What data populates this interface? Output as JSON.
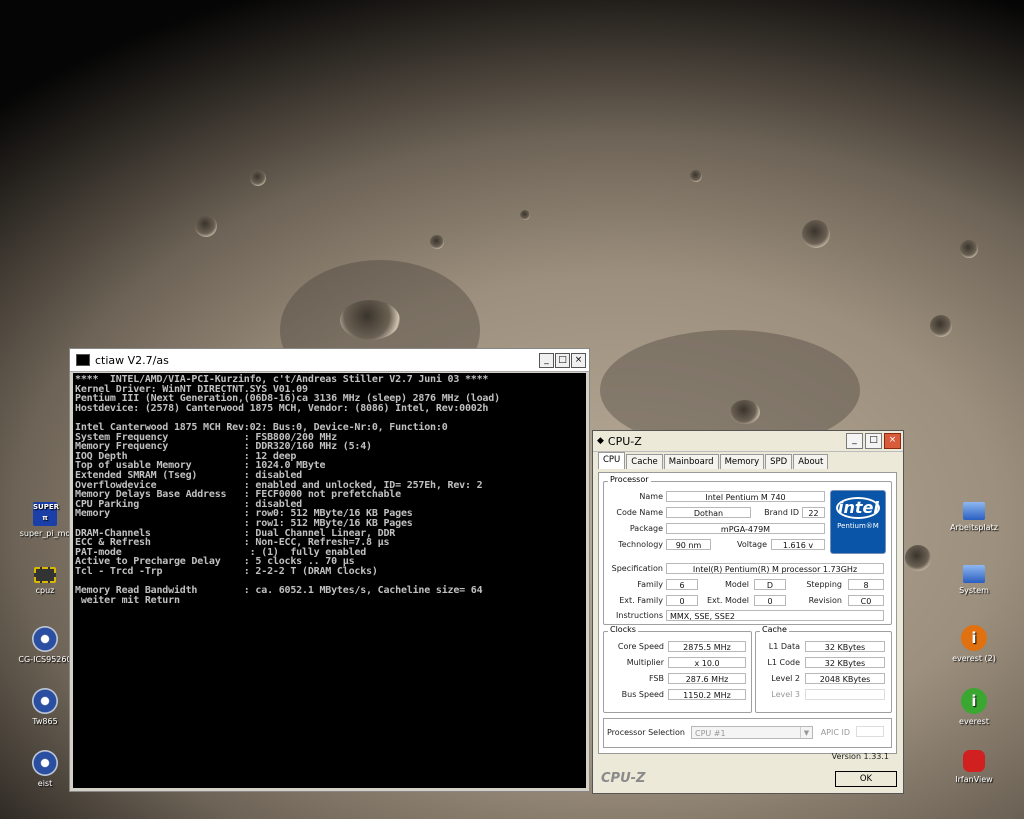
{
  "desktop": {
    "icons_left": [
      {
        "label": "super_pi_mo"
      },
      {
        "label": "cpuz"
      },
      {
        "label": "CG-ICS95260"
      },
      {
        "label": "Tw865"
      },
      {
        "label": "eist"
      }
    ],
    "icons_right": [
      {
        "label": "Arbeitsplatz"
      },
      {
        "label": "System"
      },
      {
        "label": "everest (2)"
      },
      {
        "label": "everest"
      },
      {
        "label": "IrfanView"
      }
    ]
  },
  "console": {
    "title": "ctiaw V2.7/as",
    "lines": [
      "****  INTEL/AMD/VIA-PCI-Kurzinfo, c't/Andreas Stiller V2.7 Juni 03 ****",
      "Kernel Driver: WinNT DIRECTNT.SYS V01.09",
      "Pentium III (Next Generation,(06D8-16)ca 3136 MHz (sleep) 2876 MHz (load)",
      "Hostdevice: (2578) Canterwood 1875 MCH, Vendor: (8086) Intel, Rev:0002h",
      "",
      "Intel Canterwood 1875 MCH Rev:02: Bus:0, Device-Nr:0, Function:0",
      "System Frequency             : FSB800/200 MHz",
      "Memory Frequency             : DDR320/160 MHz (5:4)",
      "IOQ Depth                    : 12 deep",
      "Top of usable Memory         : 1024.0 MByte",
      "Extended SMRAM (Tseg)        : disabled",
      "Overflowdevice               : enabled and unlocked, ID= 257Eh, Rev: 2",
      "Memory Delays Base Address   : FECF0000 not prefetchable",
      "CPU Parking                  : disabled",
      "Memory                       : row0: 512 MByte/16 KB Pages",
      "                             : row1: 512 MByte/16 KB Pages",
      "DRAM-Channels                : Dual Channel Linear, DDR",
      "ECC & Refresh                : Non-ECC, Refresh=7.8 µs",
      "PAT-mode                      : (1)  fully enabled",
      "Active to Precharge Delay    : 5 clocks .. 70 µs",
      "Tcl - Trcd -Trp              : 2-2-2 T (DRAM Clocks)",
      "",
      "Memory Read Bandwidth        : ca. 6052.1 MBytes/s, Cacheline size= 64",
      " weiter mit Return"
    ]
  },
  "cpuz": {
    "title": "CPU-Z",
    "tabs": [
      "CPU",
      "Cache",
      "Mainboard",
      "Memory",
      "SPD",
      "About"
    ],
    "processor": {
      "group": "Processor",
      "name_label": "Name",
      "name": "Intel Pentium M 740",
      "codename_label": "Code Name",
      "codename": "Dothan",
      "brandid_label": "Brand ID",
      "brandid": "22",
      "package_label": "Package",
      "package": "mPGA-479M",
      "technology_label": "Technology",
      "technology": "90 nm",
      "voltage_label": "Voltage",
      "voltage": "1.616 v",
      "spec_label": "Specification",
      "spec": "Intel(R) Pentium(R) M processor 1.73GHz",
      "family_label": "Family",
      "family": "6",
      "model_label": "Model",
      "model": "D",
      "stepping_label": "Stepping",
      "stepping": "8",
      "extfamily_label": "Ext. Family",
      "extfamily": "0",
      "extmodel_label": "Ext. Model",
      "extmodel": "0",
      "revision_label": "Revision",
      "revision": "C0",
      "instructions_label": "Instructions",
      "instructions": "MMX, SSE, SSE2",
      "logo": "intel",
      "logo_sub": "Pentium®M"
    },
    "clocks": {
      "group": "Clocks",
      "core_label": "Core Speed",
      "core": "2875.5 MHz",
      "mult_label": "Multiplier",
      "mult": "x 10.0",
      "fsb_label": "FSB",
      "fsb": "287.6 MHz",
      "bus_label": "Bus Speed",
      "bus": "1150.2 MHz"
    },
    "cache": {
      "group": "Cache",
      "l1d_label": "L1 Data",
      "l1d": "32 KBytes",
      "l1c_label": "L1 Code",
      "l1c": "32 KBytes",
      "l2_label": "Level 2",
      "l2": "2048 KBytes",
      "l3_label": "Level 3",
      "l3": ""
    },
    "selection_label": "Processor Selection",
    "selection_value": "CPU #1",
    "apic_label": "APIC ID",
    "version": "Version 1.33.1",
    "brand": "CPU-Z",
    "ok": "OK"
  }
}
